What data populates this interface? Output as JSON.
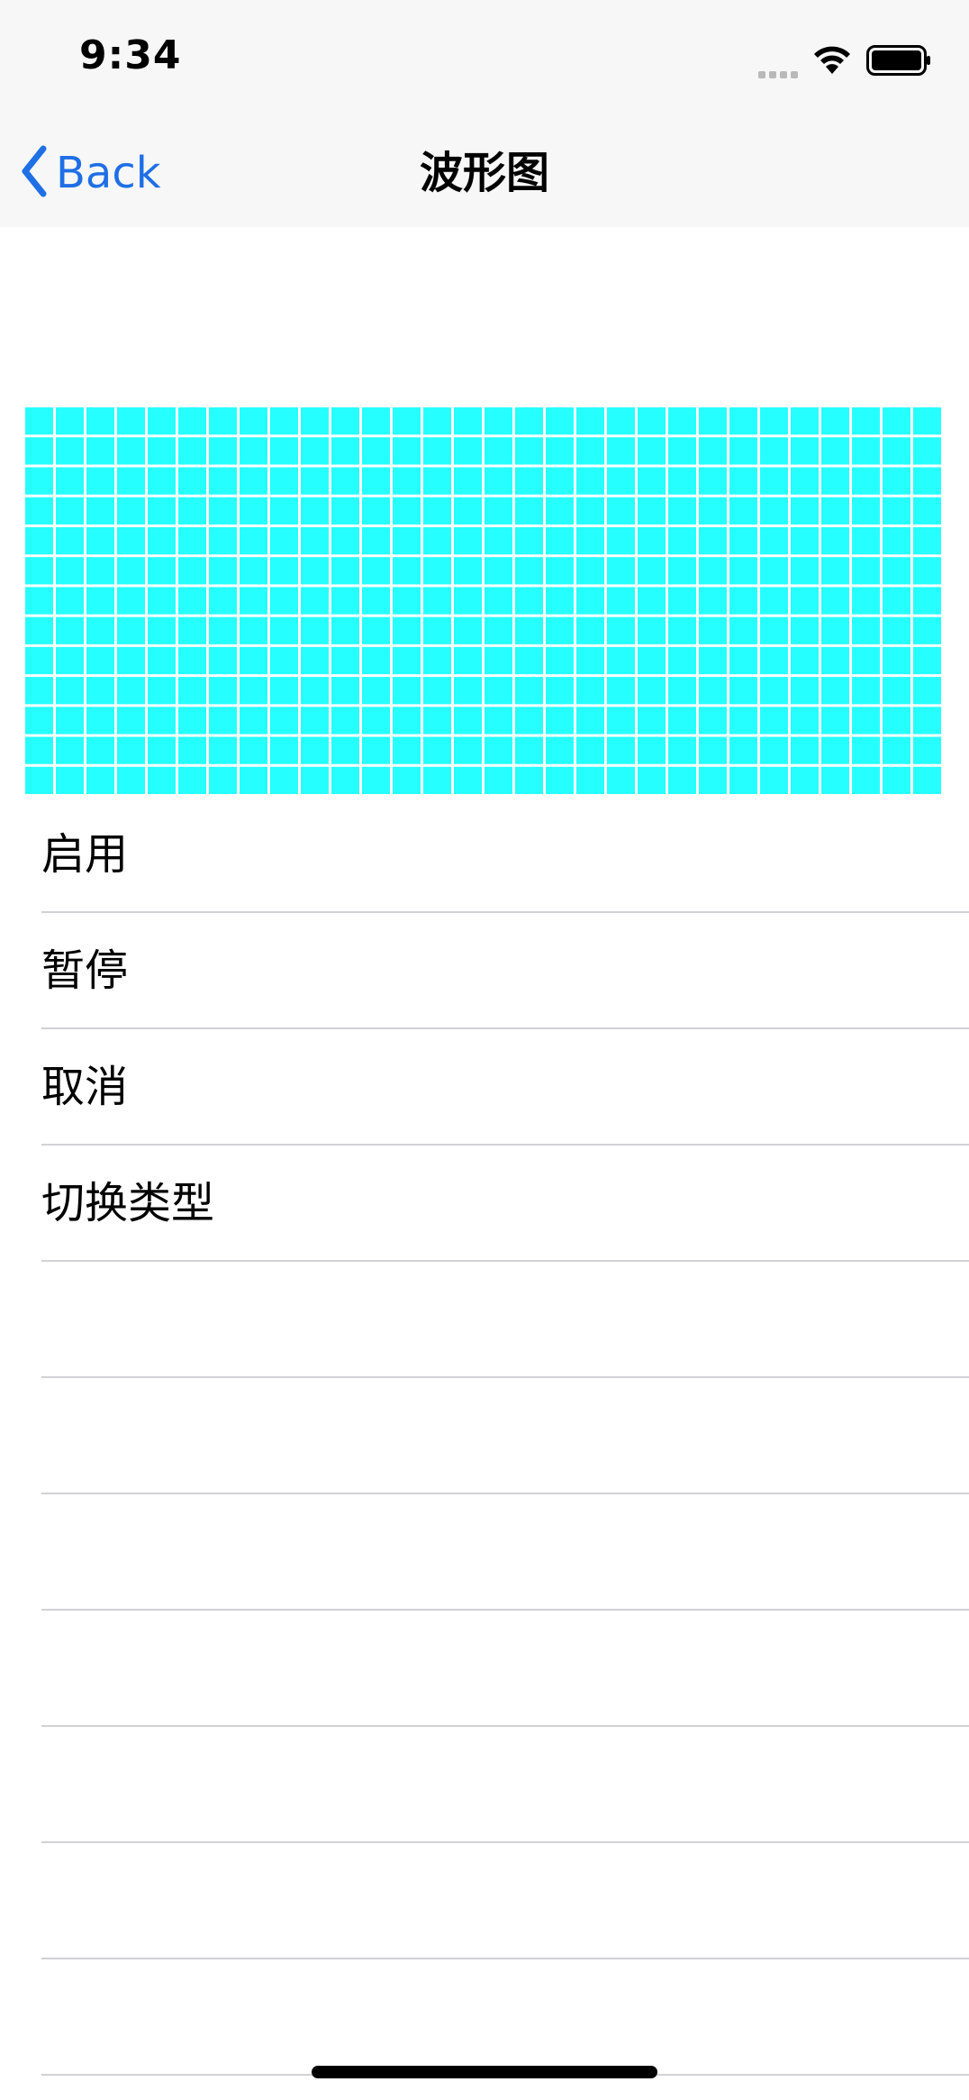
{
  "status_bar": {
    "time": "9:34"
  },
  "nav": {
    "back_label": "Back",
    "title": "波形图"
  },
  "waveform": {
    "color": "#26ffff",
    "grid_color": "#ffffff"
  },
  "actions": [
    {
      "label": "启用"
    },
    {
      "label": "暂停"
    },
    {
      "label": "取消"
    },
    {
      "label": "切换类型"
    },
    {
      "label": ""
    },
    {
      "label": ""
    },
    {
      "label": ""
    },
    {
      "label": ""
    },
    {
      "label": ""
    },
    {
      "label": ""
    },
    {
      "label": ""
    }
  ],
  "icons": {
    "back": "chevron-left-icon",
    "signal": "cellular-signal-icon",
    "wifi": "wifi-icon",
    "battery": "battery-icon"
  }
}
